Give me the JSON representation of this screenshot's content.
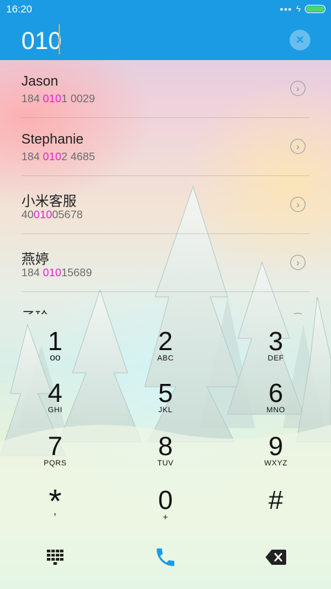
{
  "status_bar": {
    "time": "16:20",
    "dots": "•••",
    "charging": "ϟ"
  },
  "search": {
    "query": "010",
    "clear_icon": "×"
  },
  "results": [
    {
      "name": "Jason",
      "number_prefix": "184 ",
      "number_match": "010",
      "number_suffix": "1 0029"
    },
    {
      "name": "Stephanie",
      "number_prefix": "184 ",
      "number_match": "010",
      "number_suffix": "2 4685"
    },
    {
      "name": "小米客服",
      "number_prefix": "40",
      "number_match": "010",
      "number_suffix": "05678"
    },
    {
      "name": "燕婷",
      "number_prefix": "184 ",
      "number_match": "010",
      "number_suffix": "15689"
    },
    {
      "name": "子玲",
      "number_prefix": "",
      "number_match": "",
      "number_suffix": ""
    }
  ],
  "dialpad": {
    "keys": [
      {
        "digit": "1",
        "letters": "ᴏᴏ"
      },
      {
        "digit": "2",
        "letters": "ABC"
      },
      {
        "digit": "3",
        "letters": "DEF"
      },
      {
        "digit": "4",
        "letters": "GHI"
      },
      {
        "digit": "5",
        "letters": "JKL"
      },
      {
        "digit": "6",
        "letters": "MNO"
      },
      {
        "digit": "7",
        "letters": "PQRS"
      },
      {
        "digit": "8",
        "letters": "TUV"
      },
      {
        "digit": "9",
        "letters": "WXYZ"
      },
      {
        "digit": "*",
        "letters": ","
      },
      {
        "digit": "0",
        "letters": "+"
      },
      {
        "digit": "#",
        "letters": ""
      }
    ]
  },
  "colors": {
    "header_bg": "#1b9be3",
    "match_highlight": "#e021d0",
    "call_button": "#1b9be3",
    "cursor": "#f3a33b"
  },
  "icons": {
    "dialpad_toggle": "dialpad-grid-icon",
    "call": "phone-icon",
    "backspace": "backspace-icon",
    "chevron": "chevron-right-icon"
  }
}
